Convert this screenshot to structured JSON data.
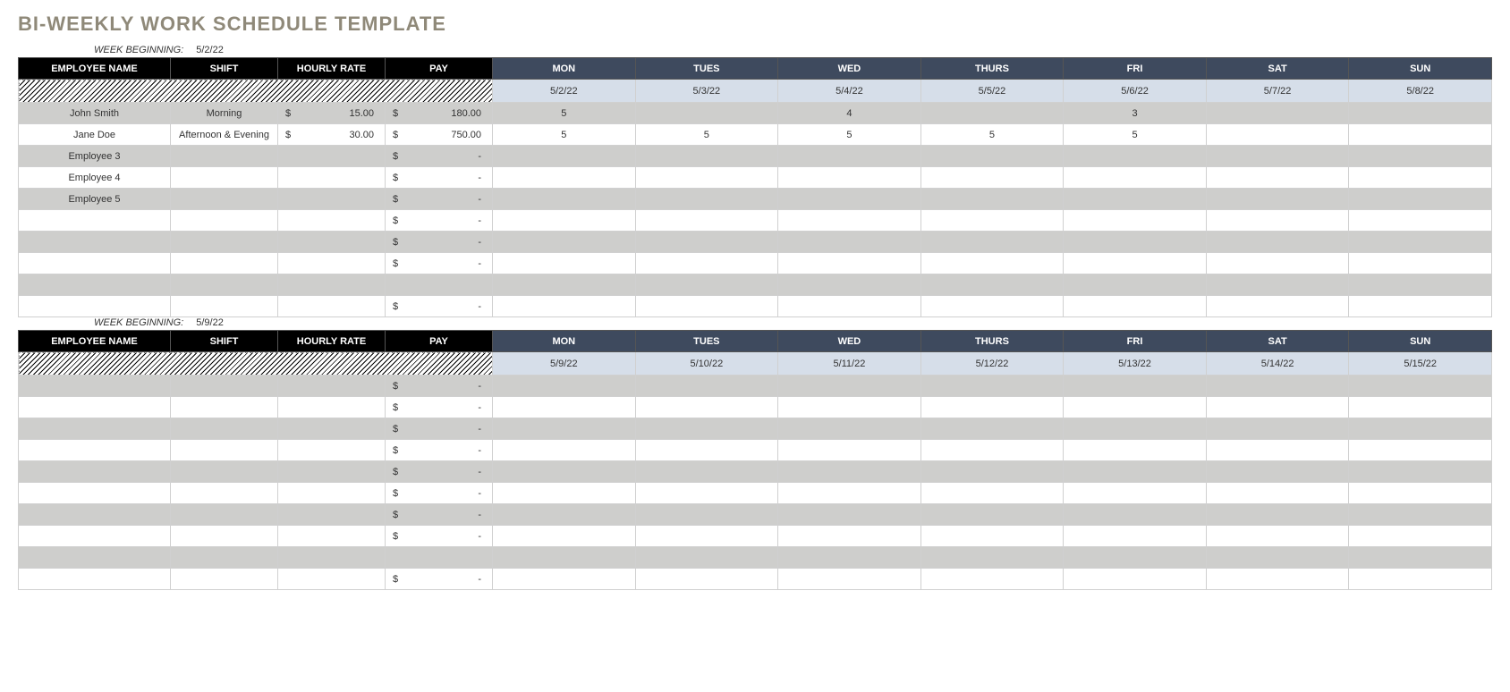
{
  "title": "BI-WEEKLY WORK SCHEDULE TEMPLATE",
  "week_beginning_label": "WEEK BEGINNING:",
  "headers": {
    "employee_name": "EMPLOYEE NAME",
    "shift": "SHIFT",
    "hourly_rate": "HOURLY RATE",
    "pay": "PAY",
    "days": [
      "MON",
      "TUES",
      "WED",
      "THURS",
      "FRI",
      "SAT",
      "SUN"
    ]
  },
  "currency_symbol": "$",
  "dash": "-",
  "weeks": [
    {
      "beginning": "5/2/22",
      "dates": [
        "5/2/22",
        "5/3/22",
        "5/4/22",
        "5/5/22",
        "5/6/22",
        "5/7/22",
        "5/8/22"
      ],
      "rows": [
        {
          "name": "John Smith",
          "shift": "Morning",
          "rate": "15.00",
          "pay": "180.00",
          "days": [
            "5",
            "",
            "4",
            "",
            "3",
            "",
            ""
          ]
        },
        {
          "name": "Jane Doe",
          "shift": "Afternoon & Evening",
          "rate": "30.00",
          "pay": "750.00",
          "days": [
            "5",
            "5",
            "5",
            "5",
            "5",
            "",
            ""
          ]
        },
        {
          "name": "Employee 3",
          "shift": "",
          "rate": "",
          "pay": "-",
          "days": [
            "",
            "",
            "",
            "",
            "",
            "",
            ""
          ]
        },
        {
          "name": "Employee 4",
          "shift": "",
          "rate": "",
          "pay": "-",
          "days": [
            "",
            "",
            "",
            "",
            "",
            "",
            ""
          ]
        },
        {
          "name": "Employee 5",
          "shift": "",
          "rate": "",
          "pay": "-",
          "days": [
            "",
            "",
            "",
            "",
            "",
            "",
            ""
          ]
        },
        {
          "name": "",
          "shift": "",
          "rate": "",
          "pay": "-",
          "days": [
            "",
            "",
            "",
            "",
            "",
            "",
            ""
          ]
        },
        {
          "name": "",
          "shift": "",
          "rate": "",
          "pay": "-",
          "days": [
            "",
            "",
            "",
            "",
            "",
            "",
            ""
          ]
        },
        {
          "name": "",
          "shift": "",
          "rate": "",
          "pay": "-",
          "days": [
            "",
            "",
            "",
            "",
            "",
            "",
            ""
          ]
        },
        {
          "name": "",
          "shift": "",
          "rate": "",
          "pay": "",
          "days": [
            "",
            "",
            "",
            "",
            "",
            "",
            ""
          ]
        },
        {
          "name": "",
          "shift": "",
          "rate": "",
          "pay": "-",
          "days": [
            "",
            "",
            "",
            "",
            "",
            "",
            ""
          ]
        }
      ]
    },
    {
      "beginning": "5/9/22",
      "dates": [
        "5/9/22",
        "5/10/22",
        "5/11/22",
        "5/12/22",
        "5/13/22",
        "5/14/22",
        "5/15/22"
      ],
      "rows": [
        {
          "name": "",
          "shift": "",
          "rate": "",
          "pay": "-",
          "days": [
            "",
            "",
            "",
            "",
            "",
            "",
            ""
          ]
        },
        {
          "name": "",
          "shift": "",
          "rate": "",
          "pay": "-",
          "days": [
            "",
            "",
            "",
            "",
            "",
            "",
            ""
          ]
        },
        {
          "name": "",
          "shift": "",
          "rate": "",
          "pay": "-",
          "days": [
            "",
            "",
            "",
            "",
            "",
            "",
            ""
          ]
        },
        {
          "name": "",
          "shift": "",
          "rate": "",
          "pay": "-",
          "days": [
            "",
            "",
            "",
            "",
            "",
            "",
            ""
          ]
        },
        {
          "name": "",
          "shift": "",
          "rate": "",
          "pay": "-",
          "days": [
            "",
            "",
            "",
            "",
            "",
            "",
            ""
          ]
        },
        {
          "name": "",
          "shift": "",
          "rate": "",
          "pay": "-",
          "days": [
            "",
            "",
            "",
            "",
            "",
            "",
            ""
          ]
        },
        {
          "name": "",
          "shift": "",
          "rate": "",
          "pay": "-",
          "days": [
            "",
            "",
            "",
            "",
            "",
            "",
            ""
          ]
        },
        {
          "name": "",
          "shift": "",
          "rate": "",
          "pay": "-",
          "days": [
            "",
            "",
            "",
            "",
            "",
            "",
            ""
          ]
        },
        {
          "name": "",
          "shift": "",
          "rate": "",
          "pay": "",
          "days": [
            "",
            "",
            "",
            "",
            "",
            "",
            ""
          ]
        },
        {
          "name": "",
          "shift": "",
          "rate": "",
          "pay": "-",
          "days": [
            "",
            "",
            "",
            "",
            "",
            "",
            ""
          ]
        }
      ]
    }
  ]
}
